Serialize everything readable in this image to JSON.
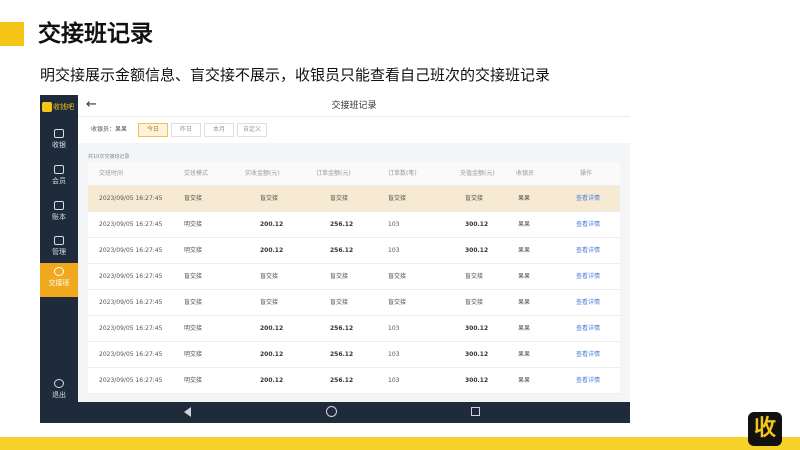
{
  "slide": {
    "title": "交接班记录",
    "subtitle": "明交接展示金额信息、盲交接不展示，收银员只能查看自己班次的交接班记录",
    "logo_char": "收"
  },
  "sidebar": {
    "app_name": "收钱吧",
    "items": [
      {
        "label": "收银",
        "icon": "register-icon"
      },
      {
        "label": "会员",
        "icon": "member-icon"
      },
      {
        "label": "账本",
        "icon": "ledger-icon"
      },
      {
        "label": "管理",
        "icon": "settings-icon"
      },
      {
        "label": "交接班",
        "icon": "handover-icon"
      },
      {
        "label": "退出",
        "icon": "power-icon"
      }
    ]
  },
  "header": {
    "title": "交接班记录",
    "back": "←"
  },
  "filter": {
    "label": "收银员：果果",
    "options": [
      "今日",
      "昨日",
      "本月",
      "自定义"
    ],
    "selected": "今日"
  },
  "record_count": "共10次交接班记录",
  "table": {
    "columns": [
      "交班时间",
      "交班模式",
      "实收金额(元)",
      "订单金额(元)",
      "订单数(笔)",
      "充值金额(元)",
      "收银员",
      "操作"
    ],
    "rows": [
      [
        "2023/09/05 16:27:45",
        "盲交接",
        "盲交接",
        "盲交接",
        "盲交接",
        "盲交接",
        "果果",
        "查看详情"
      ],
      [
        "2023/09/05 16:27:45",
        "明交接",
        "200.12",
        "256.12",
        "103",
        "300.12",
        "果果",
        "查看详情"
      ],
      [
        "2023/09/05 16:27:45",
        "明交接",
        "200.12",
        "256.12",
        "103",
        "300.12",
        "果果",
        "查看详情"
      ],
      [
        "2023/09/05 16:27:45",
        "盲交接",
        "盲交接",
        "盲交接",
        "盲交接",
        "盲交接",
        "果果",
        "查看详情"
      ],
      [
        "2023/09/05 16:27:45",
        "盲交接",
        "盲交接",
        "盲交接",
        "盲交接",
        "盲交接",
        "果果",
        "查看详情"
      ],
      [
        "2023/09/05 16:27:45",
        "明交接",
        "200.12",
        "256.12",
        "103",
        "300.12",
        "果果",
        "查看详情"
      ],
      [
        "2023/09/05 16:27:45",
        "明交接",
        "200.12",
        "256.12",
        "103",
        "300.12",
        "果果",
        "查看详情"
      ],
      [
        "2023/09/05 16:27:45",
        "明交接",
        "200.12",
        "256.12",
        "103",
        "300.12",
        "果果",
        "查看详情"
      ]
    ]
  },
  "colors": {
    "accent": "#f5c518",
    "sidebar_bg": "#1f2a3a",
    "active_nav": "#f0a81e",
    "link": "#4a7ed6",
    "highlight_row": "#f6ead3"
  }
}
